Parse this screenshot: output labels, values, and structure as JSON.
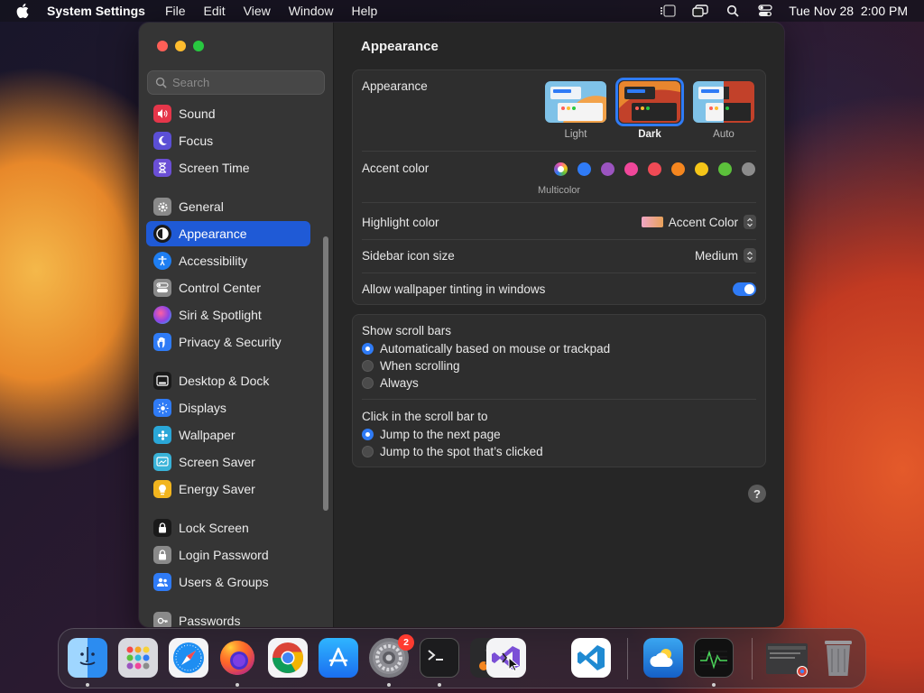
{
  "menubar": {
    "app_name": "System Settings",
    "items": [
      "File",
      "Edit",
      "View",
      "Window",
      "Help"
    ],
    "datetime": "Tue Nov 28  2:00 PM"
  },
  "search": {
    "placeholder": "Search"
  },
  "sidebar": {
    "selected": "Appearance",
    "items": [
      {
        "label": "Sound",
        "icon": "sound-icon",
        "color": "#e5364a"
      },
      {
        "label": "Focus",
        "icon": "moon-icon",
        "color": "#5b4fd6"
      },
      {
        "label": "Screen Time",
        "icon": "hourglass-icon",
        "color": "#6b4fd6"
      },
      {
        "label": "General",
        "icon": "gear-icon",
        "color": "#8a8a8a"
      },
      {
        "label": "Appearance",
        "icon": "appearance-icon",
        "color": "#1a1a1a"
      },
      {
        "label": "Accessibility",
        "icon": "accessibility-icon",
        "color": "#1e7ef2"
      },
      {
        "label": "Control Center",
        "icon": "control-center-icon",
        "color": "#8a8a8a"
      },
      {
        "label": "Siri & Spotlight",
        "icon": "siri-icon",
        "color": "#b04ad8"
      },
      {
        "label": "Privacy & Security",
        "icon": "hand-icon",
        "color": "#2f7bf6"
      },
      {
        "label": "Desktop & Dock",
        "icon": "dock-icon",
        "color": "#1a1a1a"
      },
      {
        "label": "Displays",
        "icon": "displays-icon",
        "color": "#2f7bf6"
      },
      {
        "label": "Wallpaper",
        "icon": "wallpaper-icon",
        "color": "#2aa7d8"
      },
      {
        "label": "Screen Saver",
        "icon": "screen-saver-icon",
        "color": "#39b3d8"
      },
      {
        "label": "Energy Saver",
        "icon": "bulb-icon",
        "color": "#f2b51e"
      },
      {
        "label": "Lock Screen",
        "icon": "lock-icon",
        "color": "#1a1a1a"
      },
      {
        "label": "Login Password",
        "icon": "lock-icon",
        "color": "#8a8a8a"
      },
      {
        "label": "Users & Groups",
        "icon": "users-icon",
        "color": "#2f7bf6"
      },
      {
        "label": "Passwords",
        "icon": "key-icon",
        "color": "#8a8a8a"
      }
    ]
  },
  "main": {
    "title": "Appearance",
    "appearance": {
      "label": "Appearance",
      "options": [
        "Light",
        "Dark",
        "Auto"
      ],
      "selected": "Dark"
    },
    "accent": {
      "label": "Accent color",
      "caption": "Multicolor",
      "colors": [
        "#ff6b9a",
        "#2f7bf6",
        "#9b54c0",
        "#f0479a",
        "#ef4a55",
        "#f5861f",
        "#f5c518",
        "#5cc03b",
        "#8c8c8c"
      ]
    },
    "highlight": {
      "label": "Highlight color",
      "value": "Accent Color"
    },
    "sidebar_icon": {
      "label": "Sidebar icon size",
      "value": "Medium"
    },
    "tinting": {
      "label": "Allow wallpaper tinting in windows",
      "on": true
    },
    "scroll_bars": {
      "label": "Show scroll bars",
      "options": [
        "Automatically based on mouse or trackpad",
        "When scrolling",
        "Always"
      ],
      "selected_index": 0
    },
    "click_scroll": {
      "label": "Click in the scroll bar to",
      "options": [
        "Jump to the next page",
        "Jump to the spot that’s clicked"
      ],
      "selected_index": 0
    },
    "help": "?"
  },
  "dock": {
    "settings_badge": "2"
  }
}
